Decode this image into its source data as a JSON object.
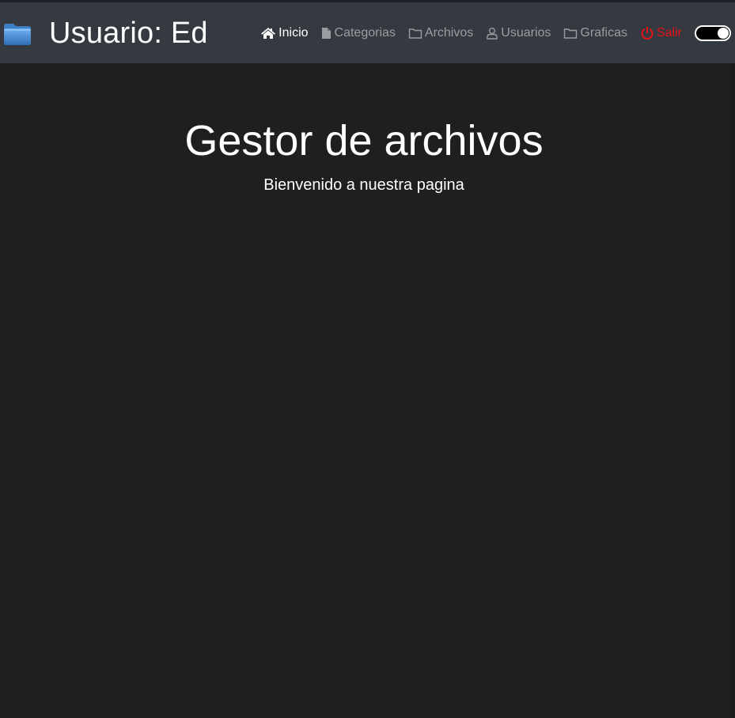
{
  "header": {
    "brand_title": "Usuario: Ed",
    "brand_icon": "folder-icon",
    "nav": {
      "inicio": "Inicio",
      "categorias": "Categorias",
      "archivos": "Archivos",
      "usuarios": "Usuarios",
      "graficas": "Graficas",
      "salir": "Salir"
    },
    "nav_icons": [
      "home-icon",
      "file-icon",
      "folder-icon",
      "user-icon",
      "folder-icon",
      "power-icon"
    ],
    "theme_toggle_on": true
  },
  "main": {
    "title": "Gestor de archivos",
    "subtitle": "Bienvenido a nuestra pagina"
  },
  "colors": {
    "background": "#1e1f21",
    "navbar": "#343a40",
    "nav_link": "#9a9da1",
    "nav_active": "#ffffff",
    "danger": "#e8121b",
    "brand_folder": "#4a8fd6"
  }
}
